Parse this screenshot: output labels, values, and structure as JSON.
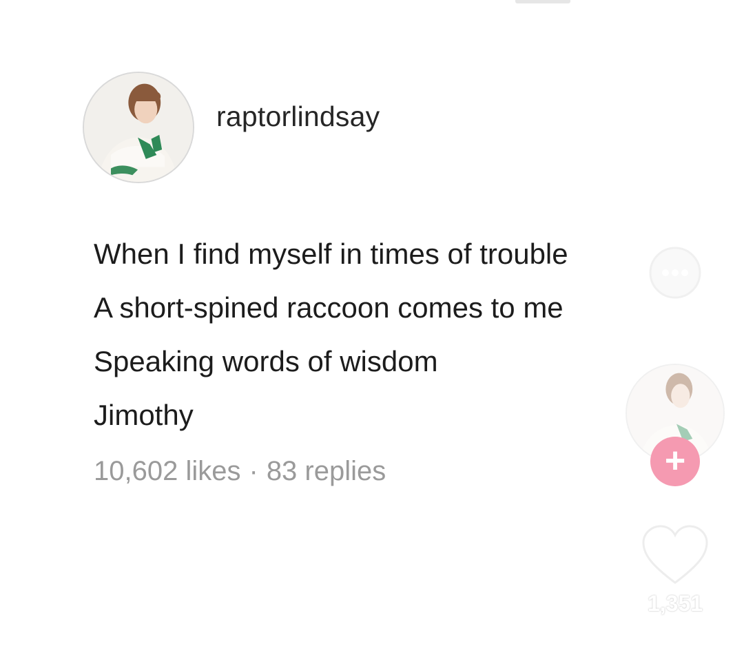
{
  "post": {
    "username": "raptorlindsay",
    "lines": [
      "When I find myself in times of trouble",
      "A short-spined raccoon comes to me",
      "Speaking words of wisdom",
      "Jimothy"
    ],
    "likes": "10,602 likes",
    "separator": "·",
    "replies": "83 replies"
  },
  "overlay": {
    "follow_label": "+",
    "like_count": "1,351",
    "icons": {
      "comment": "comment-bubble-icon",
      "like": "heart-icon",
      "follow": "plus-icon"
    },
    "colors": {
      "follow_button": "#f59ab1"
    }
  }
}
